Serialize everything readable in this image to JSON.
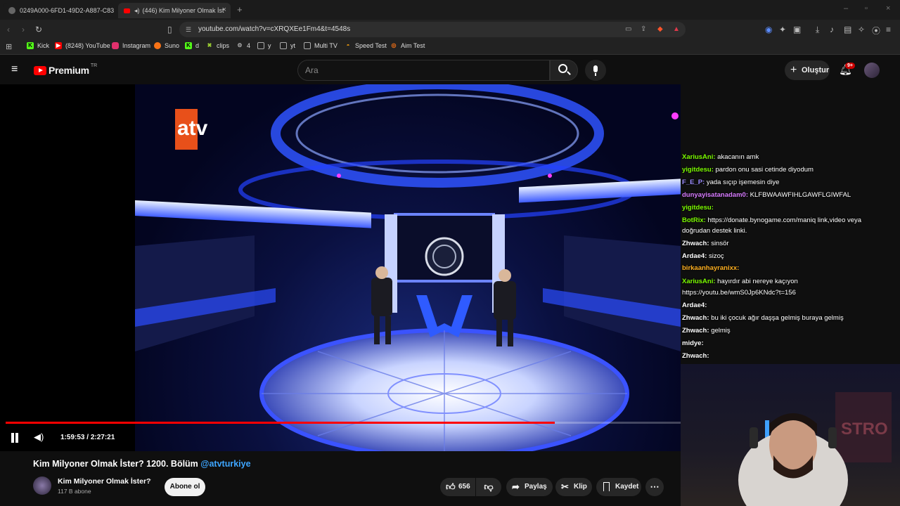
{
  "browser": {
    "tabs": [
      {
        "label": "0249A000-6FD1-49D2-A887-C83D2",
        "active": false
      },
      {
        "label": "(446) Kim Milyoner Olmak İst",
        "active": true
      }
    ],
    "new_tab_icon": "plus-icon",
    "url": "youtube.com/watch?v=cXRQXEe1Fm4&t=4548s",
    "bookmarks": [
      {
        "label": "Kick",
        "icon": "kick-icon",
        "color": "#53fc18"
      },
      {
        "label": "(8248) YouTube",
        "icon": "youtube-icon",
        "color": "#ff0000"
      },
      {
        "label": "Instagram",
        "icon": "instagram-icon",
        "color": "#e1306c"
      },
      {
        "label": "Suno",
        "icon": "suno-icon",
        "color": "#f97316"
      },
      {
        "label": "d",
        "icon": "kick-icon",
        "color": "#53fc18"
      },
      {
        "label": "clips",
        "icon": "clips-icon",
        "color": "#9acd32"
      },
      {
        "label": "4",
        "icon": "gear-icon",
        "color": "#aaaaaa"
      },
      {
        "label": "y",
        "icon": "folder-icon",
        "color": "#aaaaaa"
      },
      {
        "label": "yt",
        "icon": "folder-icon",
        "color": "#aaaaaa"
      },
      {
        "label": "Multi TV",
        "icon": "tv-icon",
        "color": "#aaaaaa"
      },
      {
        "label": "Speed Test",
        "icon": "speedtest-icon",
        "color": "#f59e0b"
      },
      {
        "label": "Aim Test",
        "icon": "aimtest-icon",
        "color": "#f97316"
      }
    ]
  },
  "youtube": {
    "logo_text": "Premium",
    "logo_region": "TR",
    "search_placeholder": "Ara",
    "create_label": "Oluştur",
    "notification_count": "9+"
  },
  "video": {
    "time_current": "1:59:53",
    "time_separator": " / ",
    "time_total": "2:27:21",
    "progress_fraction": 0.814,
    "watermark": "atv"
  },
  "stream_chat": [
    {
      "user": "XariusAni",
      "user_color": "#7cfc00",
      "msg": "akacanın amk"
    },
    {
      "user": "yigitdesu",
      "user_color": "#7cfc00",
      "msg": "pardon onu sasi cetinde diyodum"
    },
    {
      "user": "F_E_P",
      "user_color": "#9b8cff",
      "msg": "yada sıçıp işemesin diye"
    },
    {
      "user": "dunyayisatanadam0",
      "user_color": "#d77bff",
      "msg": "KLFBWAAWFIHLGAWFLGIWFAL"
    },
    {
      "user": "yigitdesu",
      "user_color": "#7cfc00",
      "msg": ""
    },
    {
      "user": "BotRix",
      "user_color": "#7cfc00",
      "msg": "https://donate.bynogame.com/maniq link,video veya"
    },
    {
      "user": "",
      "user_color": "#ffffff",
      "msg": "doğrudan destek linki."
    },
    {
      "user": "Zhwach",
      "user_color": "#ffffff",
      "msg": "sinsör"
    },
    {
      "user": "Ardae4",
      "user_color": "#ffffff",
      "msg": "sizoç"
    },
    {
      "user": "birkaanhayranixx",
      "user_color": "#ffb020",
      "msg": ""
    },
    {
      "user": "XariusAni",
      "user_color": "#7cfc00",
      "msg": "hayırdır abi nereye kaçıyon"
    },
    {
      "user": "",
      "user_color": "#ffffff",
      "msg": "https://youtu.be/wmS0Jp6KNdc?t=156"
    },
    {
      "user": "Ardae4",
      "user_color": "#ffffff",
      "msg": ""
    },
    {
      "user": "Zhwach",
      "user_color": "#ffffff",
      "msg": "bu iki çocuk ağır daşşa gelmiş buraya gelmiş"
    },
    {
      "user": "Zhwach",
      "user_color": "#ffffff",
      "msg": "gelmiş"
    },
    {
      "user": "midye",
      "user_color": "#ffffff",
      "msg": ""
    },
    {
      "user": "Zhwach",
      "user_color": "#ffffff",
      "msg": ""
    }
  ],
  "details": {
    "title": "Kim Milyoner Olmak İster? 1200. Bölüm ",
    "title_tag": "@atvturkiye",
    "channel_name": "Kim Milyoner Olmak İster?",
    "subscribers": "117 B abone",
    "subscribe_label": "Abone ol",
    "like_count": "656",
    "share_label": "Paylaş",
    "clip_label": "Klip",
    "save_label": "Kaydet"
  },
  "colors": {
    "accent_red": "#ff0000",
    "tag_blue": "#3ea6ff"
  }
}
